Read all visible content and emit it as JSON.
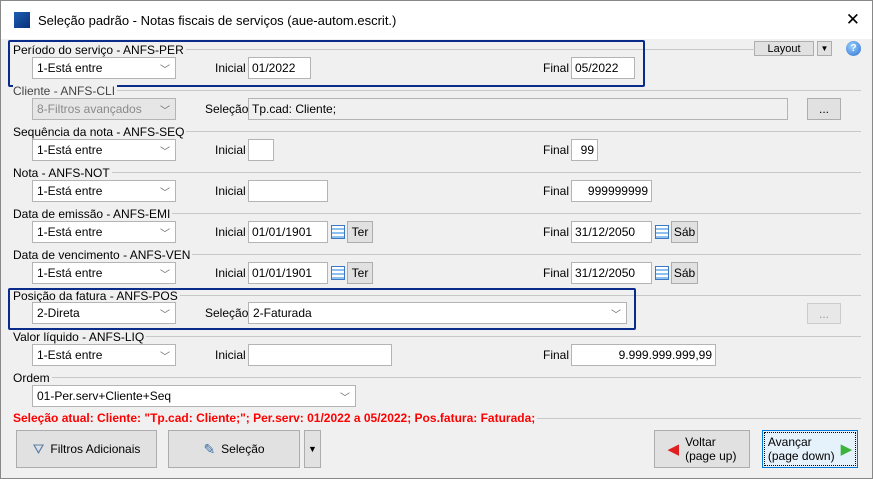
{
  "window": {
    "title": "Seleção padrão - Notas fiscais de serviços (aue-autom.escrit.)",
    "close": "✕"
  },
  "toolbar": {
    "layout": "Layout",
    "help": "?"
  },
  "fields": {
    "periodo": {
      "label": "Período do serviço - ANFS-PER",
      "op": "1-Está entre",
      "inicial_label": "Inicial",
      "inicial": "01/2022",
      "final_label": "Final",
      "final": "05/2022"
    },
    "cliente": {
      "label": "Cliente - ANFS-CLI",
      "op": "8-Filtros avançados",
      "selecao_label": "Seleção",
      "selecao": "Tp.cad: Cliente;",
      "more": "..."
    },
    "sequencia": {
      "label": "Sequência da nota - ANFS-SEQ",
      "op": "1-Está entre",
      "inicial_label": "Inicial",
      "inicial": "",
      "final_label": "Final",
      "final": "99"
    },
    "nota": {
      "label": "Nota - ANFS-NOT",
      "op": "1-Está entre",
      "inicial_label": "Inicial",
      "inicial": "",
      "final_label": "Final",
      "final": "999999999"
    },
    "emissao": {
      "label": "Data de emissão - ANFS-EMI",
      "op": "1-Está entre",
      "inicial_label": "Inicial",
      "inicial": "01/01/1901",
      "inicial_day": "Ter",
      "final_label": "Final",
      "final": "31/12/2050",
      "final_day": "Sáb"
    },
    "vencimento": {
      "label": "Data de vencimento - ANFS-VEN",
      "op": "1-Está entre",
      "inicial_label": "Inicial",
      "inicial": "01/01/1901",
      "inicial_day": "Ter",
      "final_label": "Final",
      "final": "31/12/2050",
      "final_day": "Sáb"
    },
    "posicao": {
      "label": "Posição da fatura - ANFS-POS",
      "op": "2-Direta",
      "selecao_label": "Seleção",
      "selecao": "2-Faturada",
      "more": "..."
    },
    "valor": {
      "label": "Valor líquido - ANFS-LIQ",
      "op": "1-Está entre",
      "inicial_label": "Inicial",
      "inicial": "",
      "final_label": "Final",
      "final": "9.999.999.999,99"
    },
    "ordem": {
      "label": "Ordem",
      "value": "01-Per.serv+Cliente+Seq"
    }
  },
  "status": "Seleção atual: Cliente: \"Tp.cad: Cliente;\"; Per.serv: 01/2022 a 05/2022; Pos.fatura: Faturada;",
  "buttons": {
    "filtros": "Filtros Adicionais",
    "selecao": "Seleção",
    "voltar1": "Voltar",
    "voltar2": "(page up)",
    "avancar1": "Avançar",
    "avancar2": "(page down)"
  },
  "colors": {
    "highlight": "#0b2b8a",
    "status": "#ff0000"
  }
}
